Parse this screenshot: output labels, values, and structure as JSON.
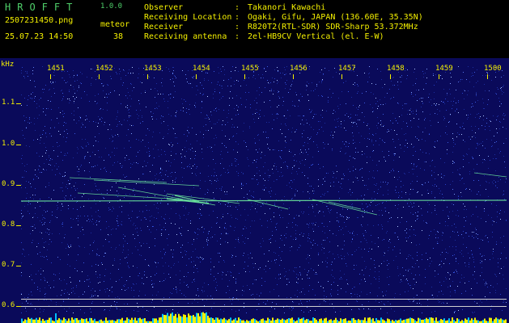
{
  "header": {
    "app_name": "HROFFT",
    "version": "1.0.0",
    "filename": "2507231450.png",
    "datetime": "25.07.23 14:50",
    "meteor_label": "meteor",
    "meteor_count": "38",
    "info": [
      {
        "label": "Observer",
        "value": "Takanori Kawachi"
      },
      {
        "label": "Receiving Location",
        "value": "Ogaki, Gifu, JAPAN (136.60E, 35.35N)"
      },
      {
        "label": "Receiver",
        "value": "R820T2(RTL-SDR) SDR-Sharp 53.372MHz"
      },
      {
        "label": "Receiving antenna",
        "value": "2el-HB9CV Vertical (el. E-W)"
      }
    ]
  },
  "spectrogram": {
    "y_unit": "kHz",
    "x_ticks": [
      "1451",
      "1452",
      "1453",
      "1454",
      "1455",
      "1456",
      "1457",
      "1458",
      "1459",
      "1500"
    ],
    "y_ticks": [
      "1.1",
      "1.0",
      "0.9",
      "0.8",
      "0.7",
      "0.6"
    ],
    "colors": {
      "background": "#0a0a5a",
      "signal": "#6ff0a0",
      "label": "#f4f000",
      "power": "#00c0ff"
    }
  }
}
